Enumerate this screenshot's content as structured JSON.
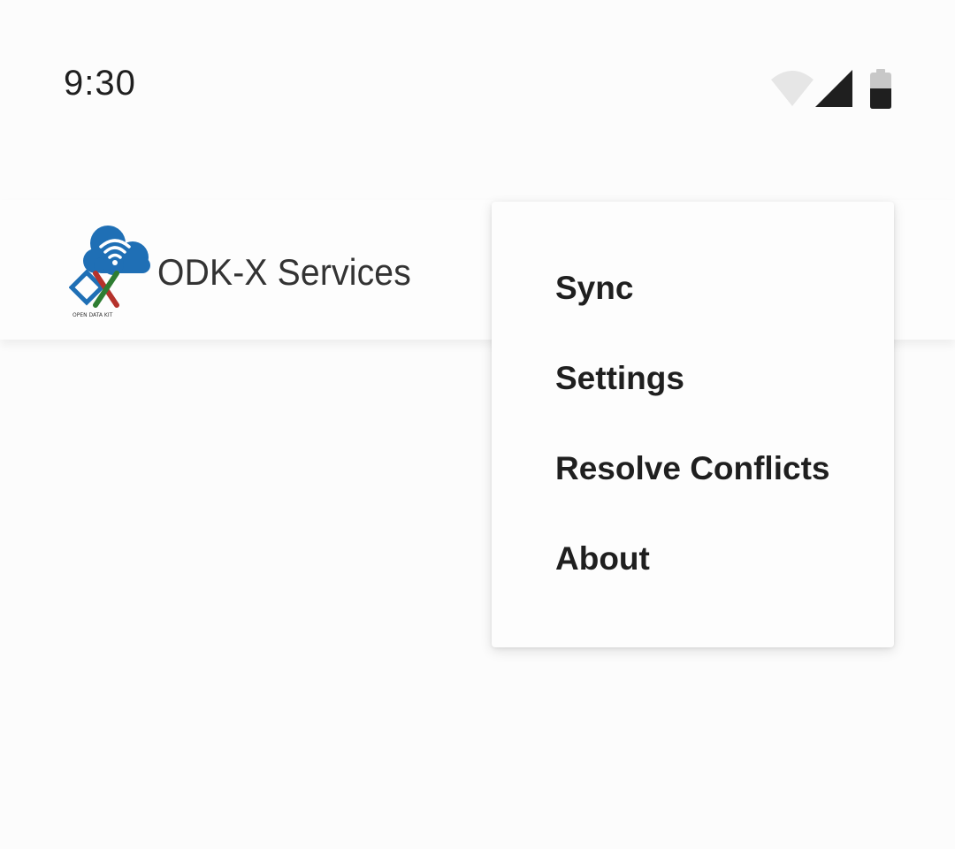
{
  "status_bar": {
    "time": "9:30",
    "icons": [
      "wifi-icon",
      "cell-signal-icon",
      "battery-icon"
    ]
  },
  "app_bar": {
    "title": "ODK-X Services",
    "logo": {
      "icon": "odk-x-cloud-logo",
      "caption": "OPEN DATA KIT"
    }
  },
  "menu": {
    "items": [
      {
        "label": "Sync"
      },
      {
        "label": "Settings"
      },
      {
        "label": "Resolve Conflicts"
      },
      {
        "label": "About"
      }
    ]
  },
  "colors": {
    "background": "#fcfcfc",
    "text": "#1f1f1f",
    "logo_blue": "#1f6fb5",
    "logo_red": "#b5322b",
    "logo_green": "#2e7d32"
  }
}
